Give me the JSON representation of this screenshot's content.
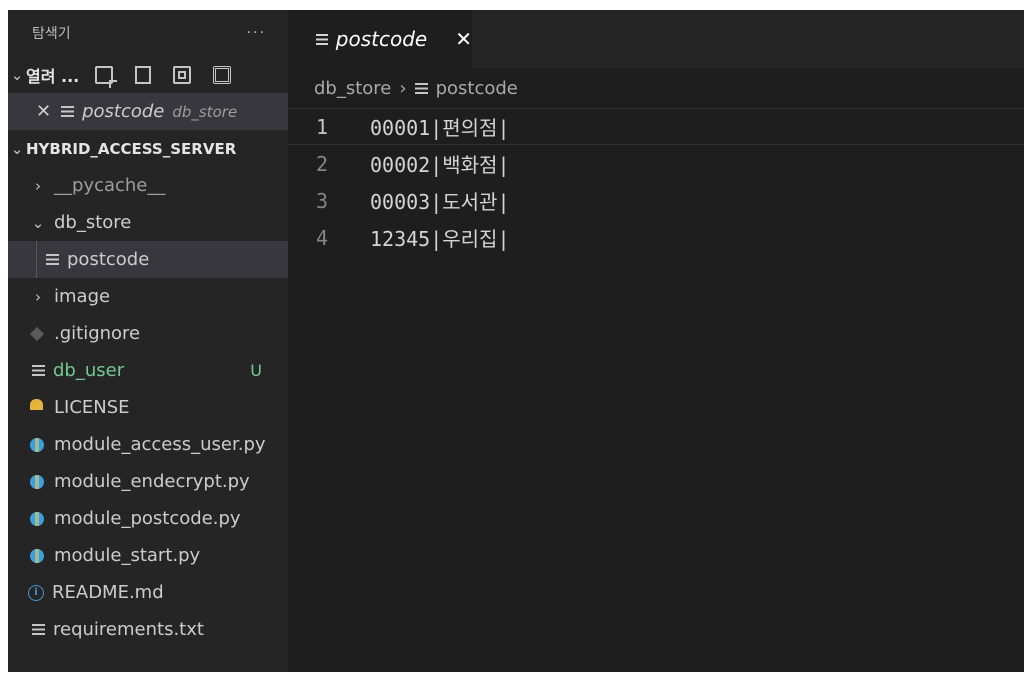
{
  "explorer": {
    "title": "탐색기",
    "more": "···",
    "open_editors": {
      "label": "열려 ...",
      "items": [
        {
          "name": "postcode",
          "desc": "db_store"
        }
      ]
    },
    "root": {
      "name": "HYBRID_ACCESS_SERVER",
      "items": [
        {
          "name": "__pycache__"
        },
        {
          "name": "db_store"
        },
        {
          "name": "postcode"
        },
        {
          "name": "image"
        },
        {
          "name": ".gitignore"
        },
        {
          "name": "db_user",
          "badge": "U"
        },
        {
          "name": "LICENSE"
        },
        {
          "name": "module_access_user.py"
        },
        {
          "name": "module_endecrypt.py"
        },
        {
          "name": "module_postcode.py"
        },
        {
          "name": "module_start.py"
        },
        {
          "name": "README.md"
        },
        {
          "name": "requirements.txt"
        }
      ]
    }
  },
  "editor": {
    "tab": {
      "label": "postcode",
      "close": "✕"
    },
    "breadcrumbs": {
      "folder": "db_store",
      "file": "postcode"
    },
    "lines": [
      {
        "num": "1",
        "text": "00001|편의점|"
      },
      {
        "num": "2",
        "text": "00002|백화점|"
      },
      {
        "num": "3",
        "text": "00003|도서관|"
      },
      {
        "num": "4",
        "text": "12345|우리집|"
      }
    ]
  },
  "colors": {
    "sidebar_bg": "#252526",
    "editor_bg": "#1e1e1e",
    "untracked_green": "#73c991",
    "selection_bg": "#37373d"
  }
}
